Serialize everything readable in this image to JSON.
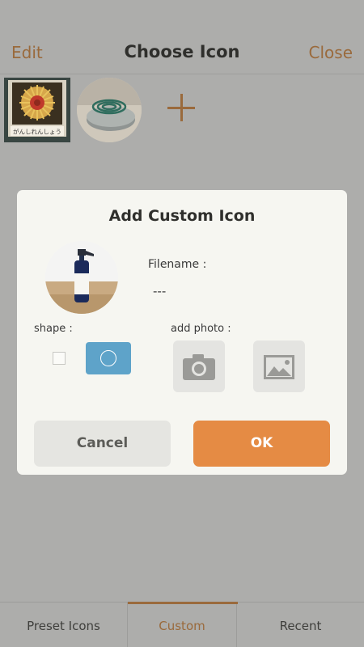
{
  "header": {
    "edit_label": "Edit",
    "title": "Choose Icon",
    "close_label": "Close"
  },
  "icon_row": {
    "icons": [
      {
        "name": "flower-photo-icon",
        "shape": "square",
        "caption": "がんしれんしょう"
      },
      {
        "name": "coil-photo-icon",
        "shape": "circle"
      }
    ],
    "add_icon": "plus-icon"
  },
  "dialog": {
    "title": "Add Custom Icon",
    "filename_label": "Filename :",
    "filename_value": "---",
    "shape_label": "shape :",
    "add_photo_label": "add photo :",
    "shape_options": [
      "square",
      "circle"
    ],
    "selected_shape": "circle",
    "photo_sources": [
      "camera-icon",
      "image-gallery-icon"
    ],
    "cancel_label": "Cancel",
    "ok_label": "OK"
  },
  "tabs": [
    {
      "label": "Preset Icons",
      "active": false
    },
    {
      "label": "Custom",
      "active": true
    },
    {
      "label": "Recent",
      "active": false
    }
  ],
  "colors": {
    "accent": "#9a6a3c",
    "ok_button": "#e58b44",
    "selected_shape": "#5ea3c9",
    "dialog_bg": "#f6f6f1",
    "overlay_bg": "#adadab"
  }
}
